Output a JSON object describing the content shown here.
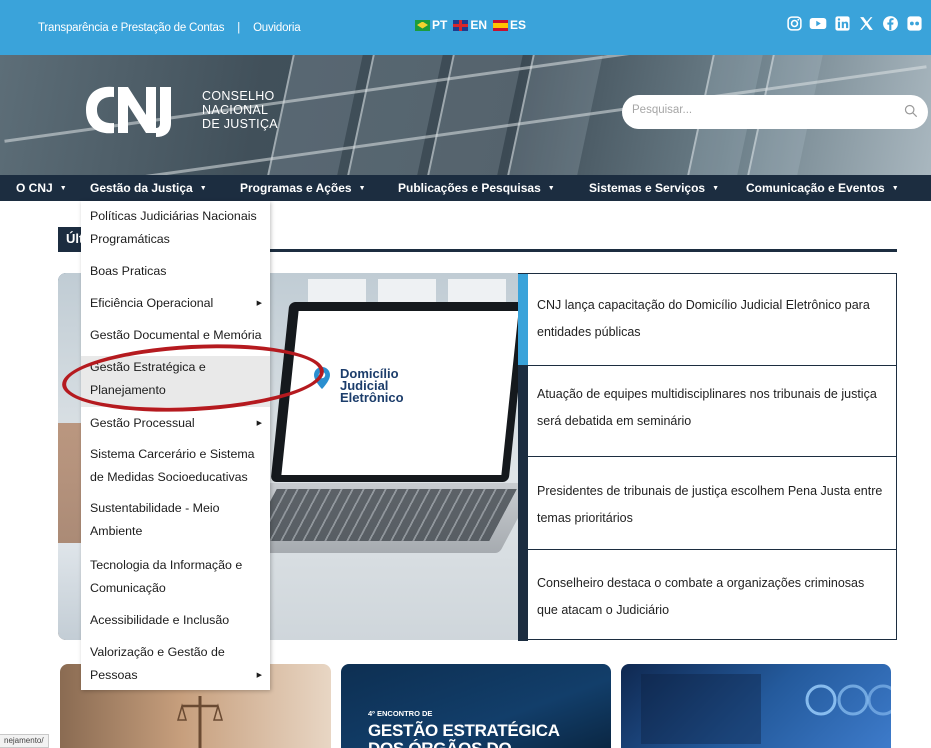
{
  "topbar": {
    "link_transparencia": "Transparência e Prestação de Contas",
    "separator": "|",
    "link_ouvidoria": "Ouvidoria",
    "languages": [
      {
        "code": "PT",
        "flag": "brazil-flag"
      },
      {
        "code": "EN",
        "flag": "uk-flag"
      },
      {
        "code": "ES",
        "flag": "spain-flag"
      }
    ],
    "social_icons": [
      "instagram-icon",
      "youtube-icon",
      "linkedin-icon",
      "x-icon",
      "facebook-icon",
      "flickr-icon"
    ]
  },
  "header": {
    "logo_letters": "CNJ",
    "logo_line1": "CONSELHO",
    "logo_line2": "NACIONAL",
    "logo_line3": "DE JUSTIÇA",
    "search_placeholder": "Pesquisar..."
  },
  "nav": {
    "items": [
      {
        "label": "O CNJ"
      },
      {
        "label": "Gestão da Justiça"
      },
      {
        "label": "Programas e Ações"
      },
      {
        "label": "Publicações e Pesquisas"
      },
      {
        "label": "Sistemas e Serviços"
      },
      {
        "label": "Comunicação e Eventos"
      }
    ]
  },
  "dropdown": {
    "items": [
      {
        "label": "Políticas Judiciárias Nacionais Programáticas",
        "has_submenu": false
      },
      {
        "label": "Boas Praticas",
        "has_submenu": false
      },
      {
        "label": "Eficiência Operacional",
        "has_submenu": true
      },
      {
        "label": "Gestão Documental e Memória",
        "has_submenu": false
      },
      {
        "label": "Gestão Estratégica e Planejamento",
        "has_submenu": false,
        "highlighted": true
      },
      {
        "label": "Gestão Processual",
        "has_submenu": true
      },
      {
        "label": "Sistema Carcerário e Sistema de Medidas Socioeducativas",
        "has_submenu": false
      },
      {
        "label": "Sustentabilidade - Meio Ambiente",
        "has_submenu": false
      },
      {
        "label": "Tecnologia da Informação e Comunicação",
        "has_submenu": false
      },
      {
        "label": "Acessibilidade e Inclusão",
        "has_submenu": false
      },
      {
        "label": "Valorização e Gestão de Pessoas",
        "has_submenu": true
      }
    ]
  },
  "section": {
    "title_visible": "Últ"
  },
  "feature": {
    "app_title_line1": "Domicílio",
    "app_title_line2": "Judicial",
    "app_title_line3": "Eletrônico"
  },
  "news": {
    "items": [
      {
        "title": "CNJ lança capacitação do Domicílio Judicial Eletrônico para entidades públicas",
        "active": true
      },
      {
        "title": "Atuação de equipes multidisciplinares nos tribunais de justiça será debatida em seminário",
        "active": false
      },
      {
        "title": "Presidentes de tribunais de justiça escolhem Pena Justa entre temas prioritários",
        "active": false
      },
      {
        "title": "Conselheiro destaca o combate a organizações criminosas que atacam o Judiciário",
        "active": false
      }
    ]
  },
  "cards": {
    "card2_kicker": "4º ENCONTRO DE",
    "card2_headline": "GESTÃO ESTRATÉGICA DOS ÓRGÃOS DO JUDICIÁRIO"
  },
  "status_url": "nejamento/",
  "colors": {
    "topbar_bg": "#3aa3da",
    "nav_bg": "#1c2d40",
    "accent_active": "#3aa3da",
    "annotation_circle": "#b51a1f"
  }
}
